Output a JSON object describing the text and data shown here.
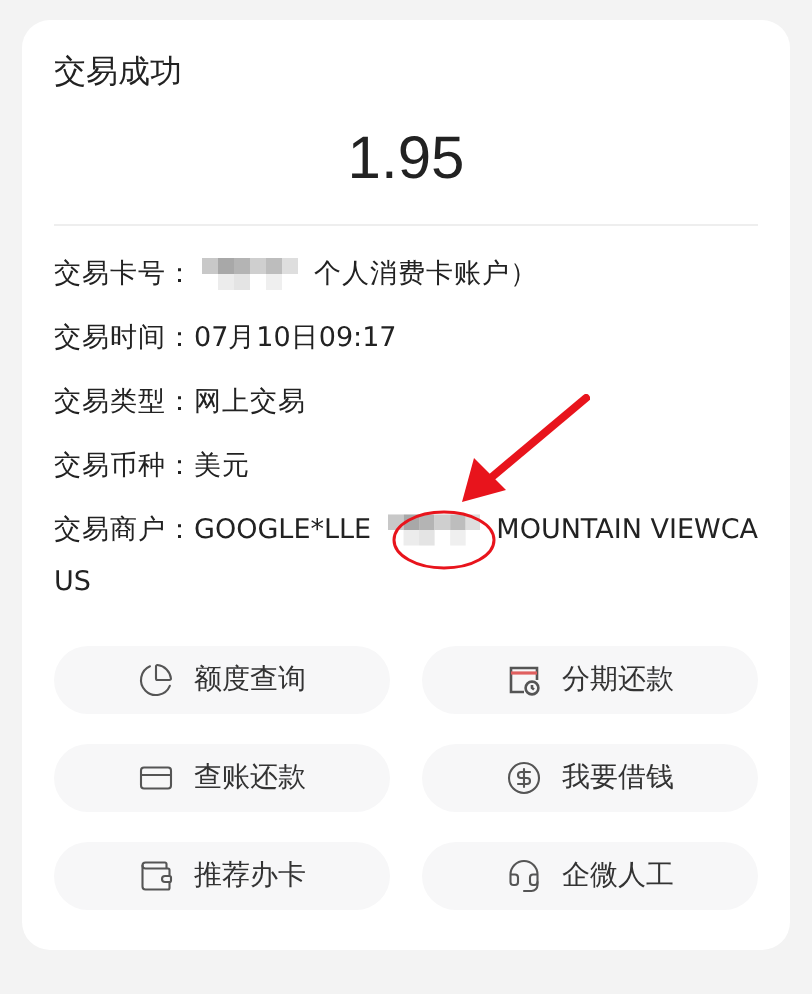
{
  "title": "交易成功",
  "amount": "1.95",
  "details": [
    {
      "label": "交易卡号：",
      "redacted": true,
      "value": "个人消费卡账户）"
    },
    {
      "label": "交易时间：",
      "value": "07月10日09:17"
    },
    {
      "label": "交易类型：",
      "value": "网上交易"
    },
    {
      "label": "交易币种：",
      "value": "美元"
    },
    {
      "label": "交易商户：",
      "value_before": "GOOGLE*LLE",
      "redacted": true,
      "value": "MOUNTAIN VIEWCA",
      "value_continued": "US"
    }
  ],
  "actions": [
    {
      "label": "额度查询"
    },
    {
      "label": "分期还款"
    },
    {
      "label": "查账还款"
    },
    {
      "label": "我要借钱"
    },
    {
      "label": "推荐办卡"
    },
    {
      "label": "企微人工"
    }
  ]
}
